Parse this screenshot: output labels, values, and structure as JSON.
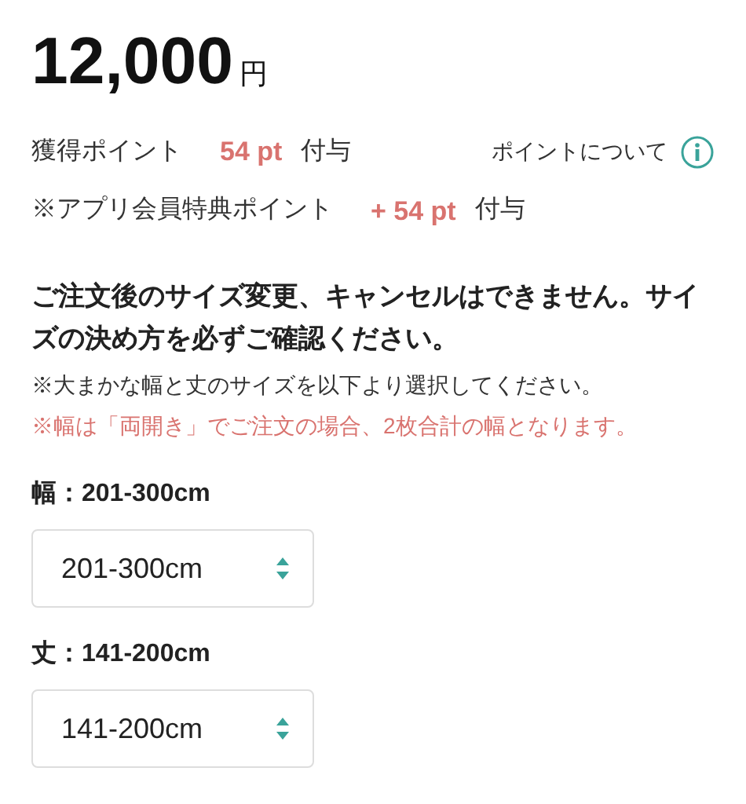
{
  "price": {
    "amount": "12,000",
    "currency": "円"
  },
  "points": {
    "label": "獲得ポイント",
    "value": "54 pt",
    "suffix": "付与",
    "link": "ポイントについて"
  },
  "app_points": {
    "label": "※アプリ会員特典ポイント",
    "value": "+ 54 pt",
    "suffix": "付与"
  },
  "notice": "ご注文後のサイズ変更、キャンセルはできません。サイズの決め方を必ずご確認ください。",
  "notes": [
    {
      "text": "※大まかな幅と丈のサイズを以下より選択してください。",
      "kind": "plain"
    },
    {
      "text": "※幅は「両開き」でご注文の場合、2枚合計の幅となります。",
      "kind": "warning"
    }
  ],
  "options": [
    {
      "label": "幅：201-300cm",
      "value": "201-300cm"
    },
    {
      "label": "丈：141-200cm",
      "value": "141-200cm"
    }
  ]
}
